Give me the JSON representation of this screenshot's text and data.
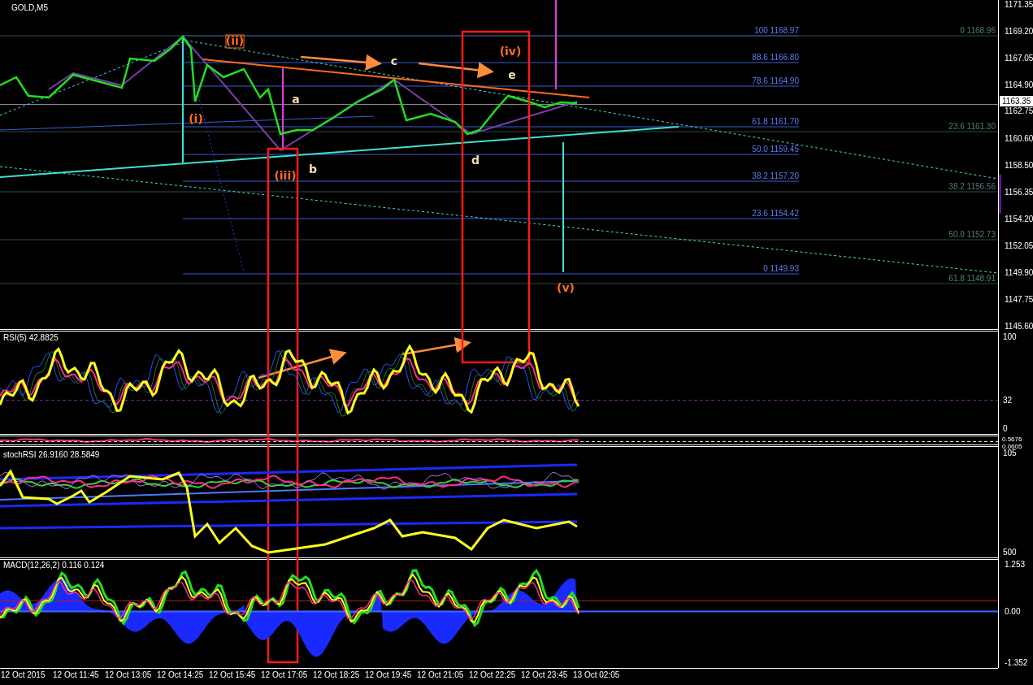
{
  "symbol": "GOLD,M5",
  "price_axis": [
    "1171.35",
    "1169.20",
    "1167.05",
    "1164.90",
    "1162.75",
    "1160.60",
    "1158.50",
    "1156.35",
    "1154.20",
    "1152.05",
    "1149.90",
    "1147.75",
    "1145.60"
  ],
  "current_price": "1163.35",
  "fib_levels_primary": [
    "100 1168.97",
    "88.6 1166.80",
    "78.6 1164.90",
    "61.8 1161.70",
    "50.0 1159.45",
    "38.2 1157.20",
    "23.6 1154.42",
    "0 1149.93"
  ],
  "fib_levels_secondary": [
    "0 1168.96",
    "23.6 1161.30",
    "38.2 1156.56",
    "50.0 1152.73",
    "61.8 1148.91"
  ],
  "wave_labels": [
    {
      "text": "(ii)",
      "color": "#ff6a1a",
      "framed": true
    },
    {
      "text": "(i)",
      "color": "#ff6a1a"
    },
    {
      "text": "a",
      "color": "#f5deb3"
    },
    {
      "text": "(iii)",
      "color": "#ff6a1a"
    },
    {
      "text": "b",
      "color": "#f5deb3"
    },
    {
      "text": "c",
      "color": "#f5deb3"
    },
    {
      "text": "d",
      "color": "#f5deb3"
    },
    {
      "text": "e",
      "color": "#f5deb3"
    },
    {
      "text": "(iv)",
      "color": "#ff6a1a"
    },
    {
      "text": "(v)",
      "color": "#ff6a1a"
    }
  ],
  "rsi": {
    "title": "RSI(5) 42.8825",
    "axis": [
      "100",
      "32",
      "0"
    ]
  },
  "mini": {
    "axis": [
      "0.5676",
      "0.0605"
    ]
  },
  "stoch_rsi": {
    "title": "stochRSI 26.9160 28.5849",
    "axis": [
      "105",
      "500"
    ]
  },
  "macd": {
    "title": "MACD(12,26,2) 0.116 0.124",
    "axis": [
      "1.253",
      "0.00",
      "-1.352"
    ]
  },
  "time_axis": [
    "12 Oct 2015",
    "12 Oct 11:45",
    "12 Oct 13:05",
    "12 Oct 14:25",
    "12 Oct 15:45",
    "12 Oct 17:05",
    "12 Oct 18:25",
    "12 Oct 19:45",
    "12 Oct 21:05",
    "12 Oct 22:25",
    "12 Oct 23:45",
    "13 Oct 02:05"
  ]
}
